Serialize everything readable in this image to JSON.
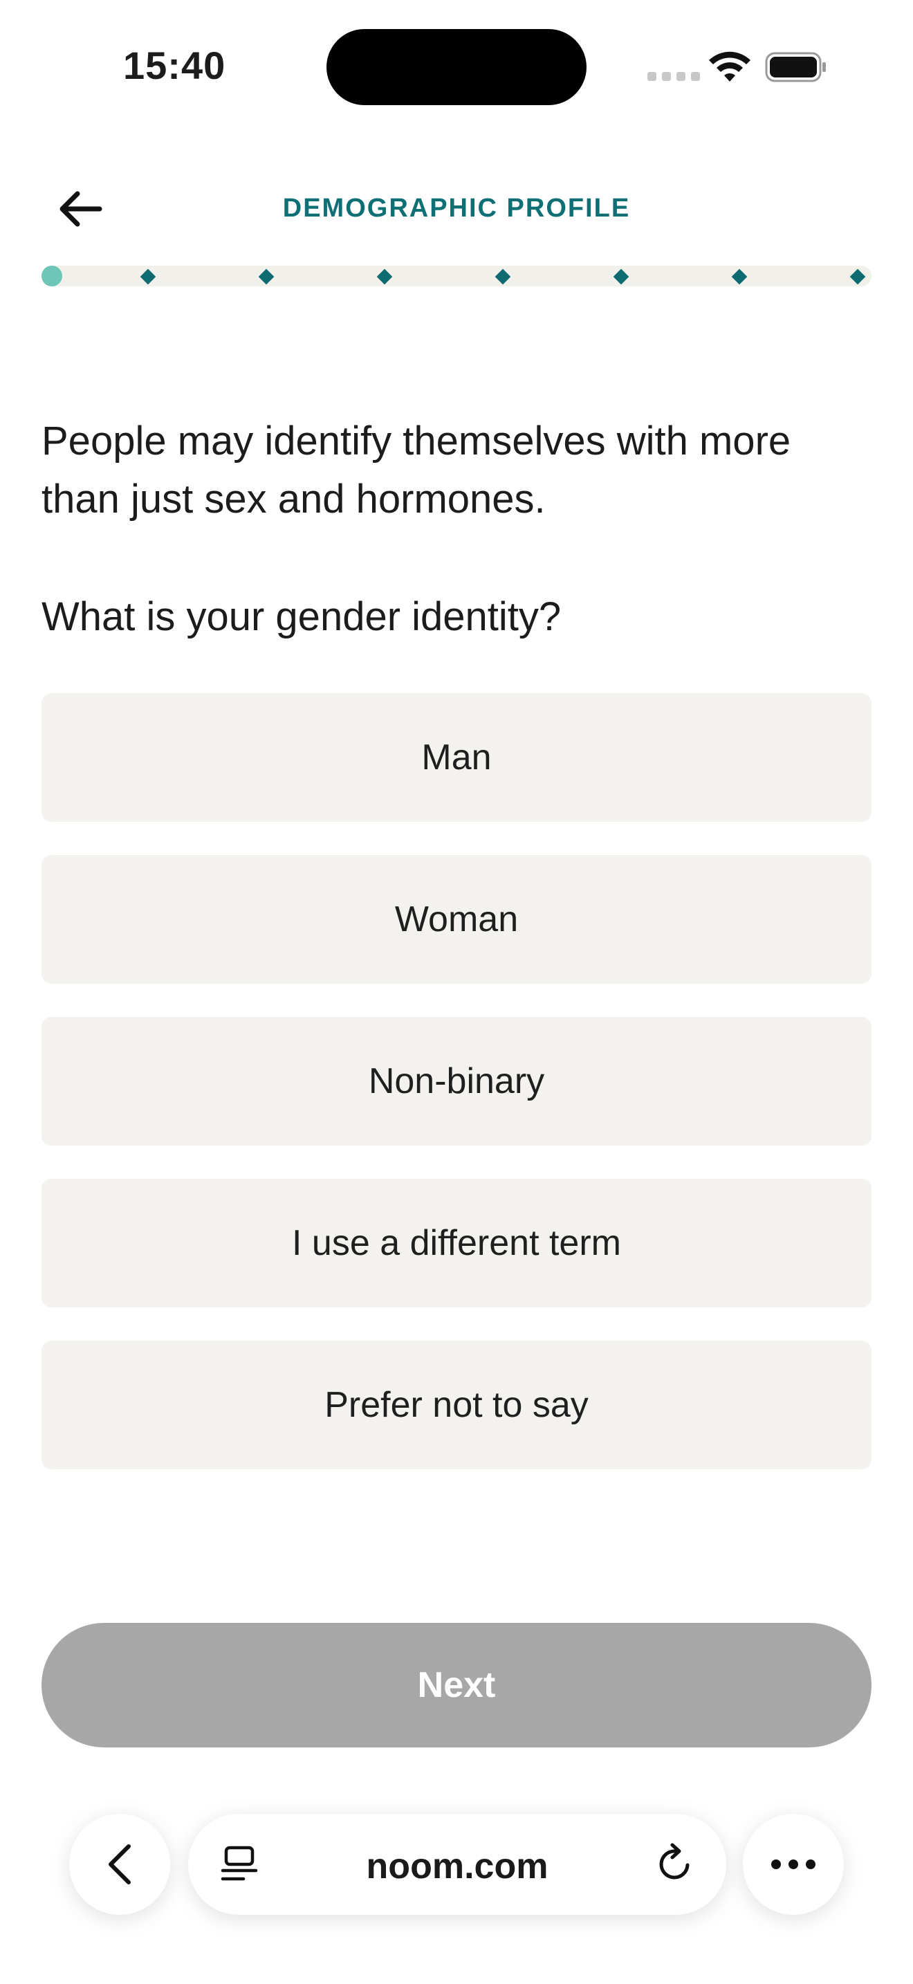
{
  "status_bar": {
    "time": "15:40"
  },
  "header": {
    "title": "DEMOGRAPHIC PROFILE",
    "back_icon": "arrow-left-icon"
  },
  "progress": {
    "total_steps": 8,
    "current_step": 1,
    "accent": "#6ec7b6",
    "marker_color": "#0f6b72"
  },
  "question": {
    "intro": "People may identify themselves with more than just sex and hormones.",
    "prompt": "What is your gender identity?"
  },
  "options": [
    {
      "label": "Man"
    },
    {
      "label": "Woman"
    },
    {
      "label": "Non-binary"
    },
    {
      "label": "I use a different term"
    },
    {
      "label": "Prefer not to say"
    }
  ],
  "next_button": {
    "label": "Next",
    "enabled": false,
    "color": "#a7a7a7"
  },
  "browser": {
    "url": "noom.com",
    "icons": [
      "chevron-left-icon",
      "tabs-icon",
      "reload-icon",
      "more-icon"
    ]
  },
  "colors": {
    "brand_teal": "#0e6f75",
    "option_bg": "#f3f2ee"
  }
}
